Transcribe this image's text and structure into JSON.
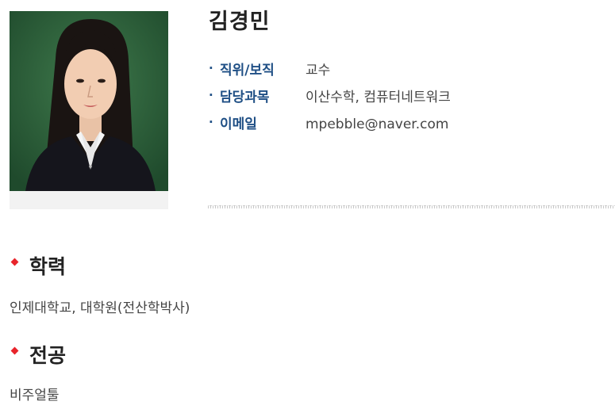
{
  "profile": {
    "name": "김경민",
    "info": [
      {
        "label": "직위/보직",
        "value": "교수"
      },
      {
        "label": "담당과목",
        "value": "이산수학, 컴퓨터네트워크"
      },
      {
        "label": "이메일",
        "value": "mpebble@naver.com"
      }
    ]
  },
  "sections": {
    "education": {
      "title": "학력",
      "body": "인제대학교, 대학원(전산학박사)"
    },
    "major": {
      "title": "전공",
      "body": "비주얼툴"
    }
  },
  "colors": {
    "label_blue": "#1f4f85",
    "accent_red": "#e8242b",
    "photo_background": "#2e5a3a"
  },
  "icons": {
    "section_marker": "diamond-icon",
    "info_marker": "bullet-dot-icon"
  }
}
